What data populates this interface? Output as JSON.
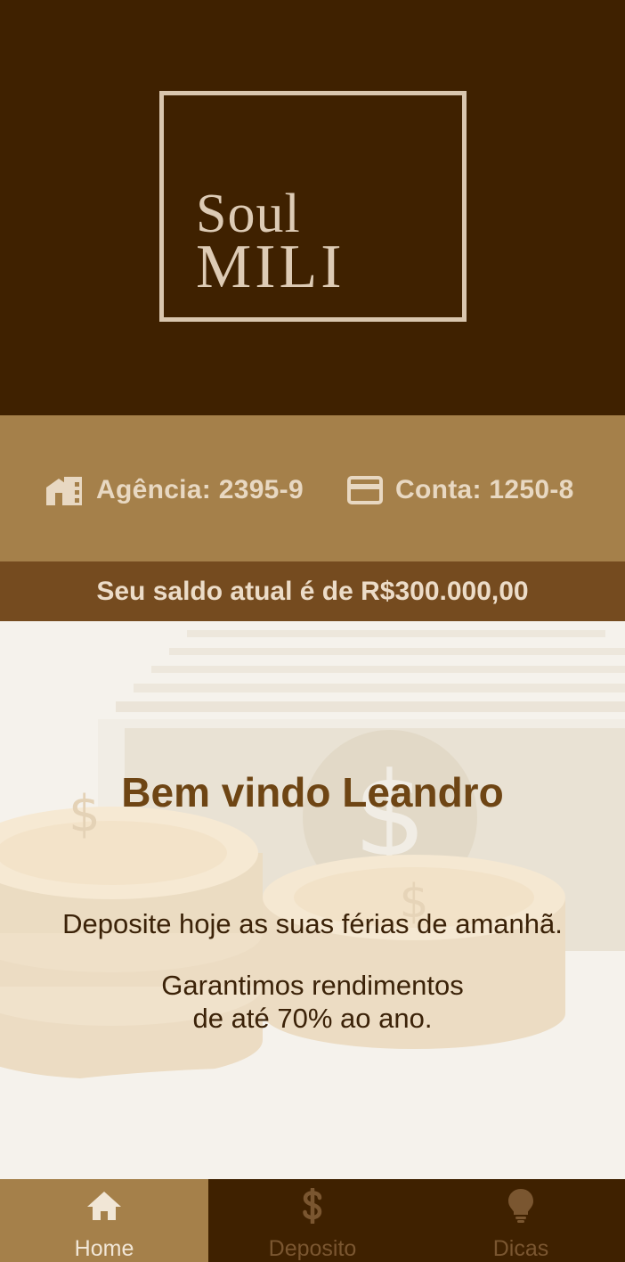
{
  "brand": {
    "line1": "Soul",
    "line2": "MILI"
  },
  "account": {
    "agencia_label": "Agência: 2395-9",
    "conta_label": "Conta: 1250-8"
  },
  "balance": {
    "text": "Seu saldo atual é de R$300.000,00"
  },
  "main": {
    "welcome": "Bem vindo Leandro",
    "tagline": "Deposite hoje as suas férias de amanhã.",
    "promo_line1": "Garantimos rendimentos",
    "promo_line2": "de até 70% ao ano."
  },
  "nav": {
    "items": [
      {
        "label": "Home",
        "icon": "home-icon",
        "active": true
      },
      {
        "label": "Deposito",
        "icon": "dollar-icon",
        "active": false
      },
      {
        "label": "Dicas",
        "icon": "lightbulb-icon",
        "active": false
      }
    ]
  },
  "colors": {
    "header_bg": "#3f2100",
    "account_bar_bg": "#a5804a",
    "balance_bar_bg": "#754b1f",
    "main_bg": "#f5f2ec",
    "accent_text": "#6e4514"
  }
}
